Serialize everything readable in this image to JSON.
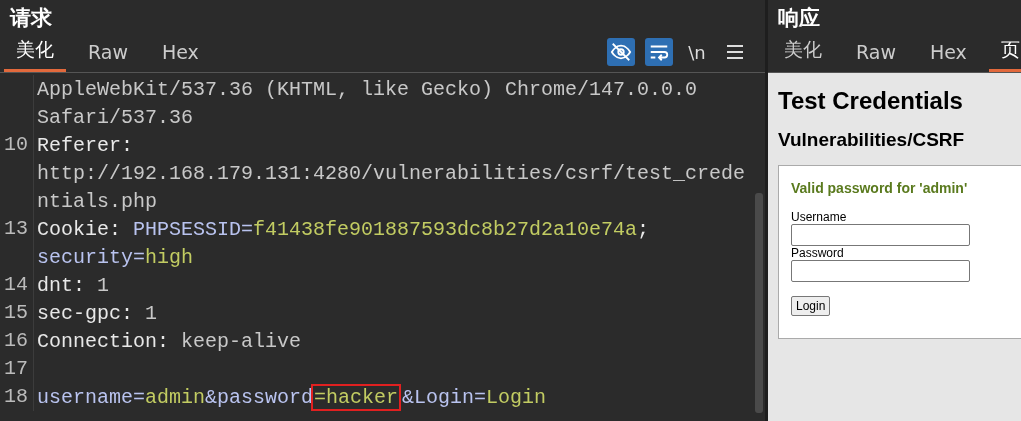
{
  "request": {
    "title": "请求",
    "tabs": [
      {
        "label": "美化",
        "selected": true
      },
      {
        "label": "Raw",
        "selected": false
      },
      {
        "label": "Hex",
        "selected": false
      }
    ],
    "toolbar": [
      {
        "kind": "hide",
        "on": true
      },
      {
        "kind": "wrap",
        "on": true
      },
      {
        "kind": "newline",
        "label": "\\n",
        "on": false
      },
      {
        "kind": "menu",
        "on": false
      }
    ],
    "lines": [
      {
        "segments": [
          {
            "text": "AppleWebKit/537.36 (KHTML, like Gecko) Chrome/147.0.0.0",
            "kind": "value"
          }
        ]
      },
      {
        "segments": [
          {
            "text": "Safari/537.36",
            "kind": "value"
          }
        ]
      },
      {
        "number": "10",
        "segments": [
          {
            "text": "Referer:",
            "kind": "header"
          }
        ]
      },
      {
        "segments": [
          {
            "text": "http://192.168.179.131:4280/vulnerabilities/csrf/test_crede",
            "kind": "value"
          }
        ]
      },
      {
        "segments": [
          {
            "text": "ntials.php",
            "kind": "value"
          }
        ]
      },
      {
        "number": "13",
        "segments": [
          {
            "text": "Cookie: ",
            "kind": "header"
          },
          {
            "text": "PHPSESSID=",
            "kind": "param"
          },
          {
            "text": "f41438fe901887593dc8b27d2a10e74a",
            "kind": "param_value"
          },
          {
            "text": ";",
            "kind": "header"
          }
        ]
      },
      {
        "segments": [
          {
            "text": "security=",
            "kind": "param"
          },
          {
            "text": "high",
            "kind": "param_value"
          }
        ]
      },
      {
        "number": "14",
        "segments": [
          {
            "text": "dnt: ",
            "kind": "header"
          },
          {
            "text": "1",
            "kind": "value"
          }
        ]
      },
      {
        "number": "15",
        "segments": [
          {
            "text": "sec-gpc: ",
            "kind": "header"
          },
          {
            "text": "1",
            "kind": "value"
          }
        ]
      },
      {
        "number": "16",
        "segments": [
          {
            "text": "Connection: ",
            "kind": "header"
          },
          {
            "text": "keep-alive",
            "kind": "value"
          }
        ]
      },
      {
        "number": "17"
      },
      {
        "number": "18",
        "segments": [
          {
            "text": "username=",
            "kind": "param"
          },
          {
            "text": "admin",
            "kind": "param_value"
          },
          {
            "text": "&password",
            "kind": "param"
          },
          {
            "text": "=hacker",
            "kind": "param_value",
            "boxed": true
          },
          {
            "text": "&Login=",
            "kind": "param"
          },
          {
            "text": "Login",
            "kind": "param_value"
          }
        ]
      }
    ]
  },
  "response": {
    "title": "响应",
    "tabs": [
      {
        "label": "美化",
        "selected": false
      },
      {
        "label": "Raw",
        "selected": false
      },
      {
        "label": "Hex",
        "selected": false
      },
      {
        "label": "页",
        "selected": true
      }
    ],
    "page": {
      "heading": "Test Credentials",
      "subheading": "Vulnerabilities/CSRF",
      "message": "Valid password for 'admin'",
      "fields": [
        {
          "label": "Username"
        },
        {
          "label": "Password"
        }
      ],
      "button": "Login"
    }
  }
}
